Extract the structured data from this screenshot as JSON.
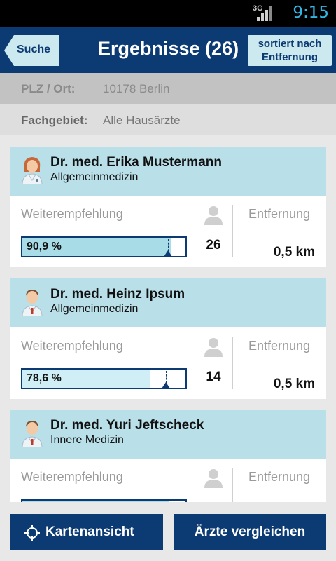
{
  "status_bar": {
    "network": "3G",
    "time": "9:15"
  },
  "header": {
    "back_label": "Suche",
    "title": "Ergebnisse (26)",
    "sort_line1": "sortiert nach",
    "sort_line2": "Entfernung"
  },
  "filters": {
    "plz_label": "PLZ / Ort:",
    "plz_value": "10178 Berlin",
    "fach_label": "Fachgebiet:",
    "fach_value": "Alle Hausärzte"
  },
  "doctors": [
    {
      "name": "Dr. med. Erika Mustermann",
      "specialty": "Allgemeinmedizin",
      "recommendation_label": "Weiterempfehlung",
      "recommendation_text": "90,9 %",
      "recommendation": 0.909,
      "rating_count": "26",
      "distance_label": "Entfernung",
      "distance": "0,5 km",
      "avatar": "female-doctor-icon"
    },
    {
      "name": "Dr. med. Heinz Ipsum",
      "specialty": "Allgemeinmedizin",
      "recommendation_label": "Weiterempfehlung",
      "recommendation_text": "78,6 %",
      "recommendation": 0.786,
      "rating_count": "14",
      "distance_label": "Entfernung",
      "distance": "0,5 km",
      "avatar": "male-doctor-icon"
    },
    {
      "name": "Dr. med. Yuri Jeftscheck",
      "specialty": "Innere Medizin",
      "recommendation_label": "Weiterempfehlung",
      "recommendation_text": "",
      "recommendation": 0.9,
      "rating_count": "",
      "distance_label": "Entfernung",
      "distance": "",
      "avatar": "male-doctor-icon"
    }
  ],
  "bottom": {
    "map_label": "Kartenansicht",
    "compare_label": "Ärzte vergleichen"
  },
  "colors": {
    "primary": "#0c3a72",
    "card_header": "#b9dfe8",
    "bar_fill": "#a8dce6",
    "status_time": "#33b5e5"
  }
}
